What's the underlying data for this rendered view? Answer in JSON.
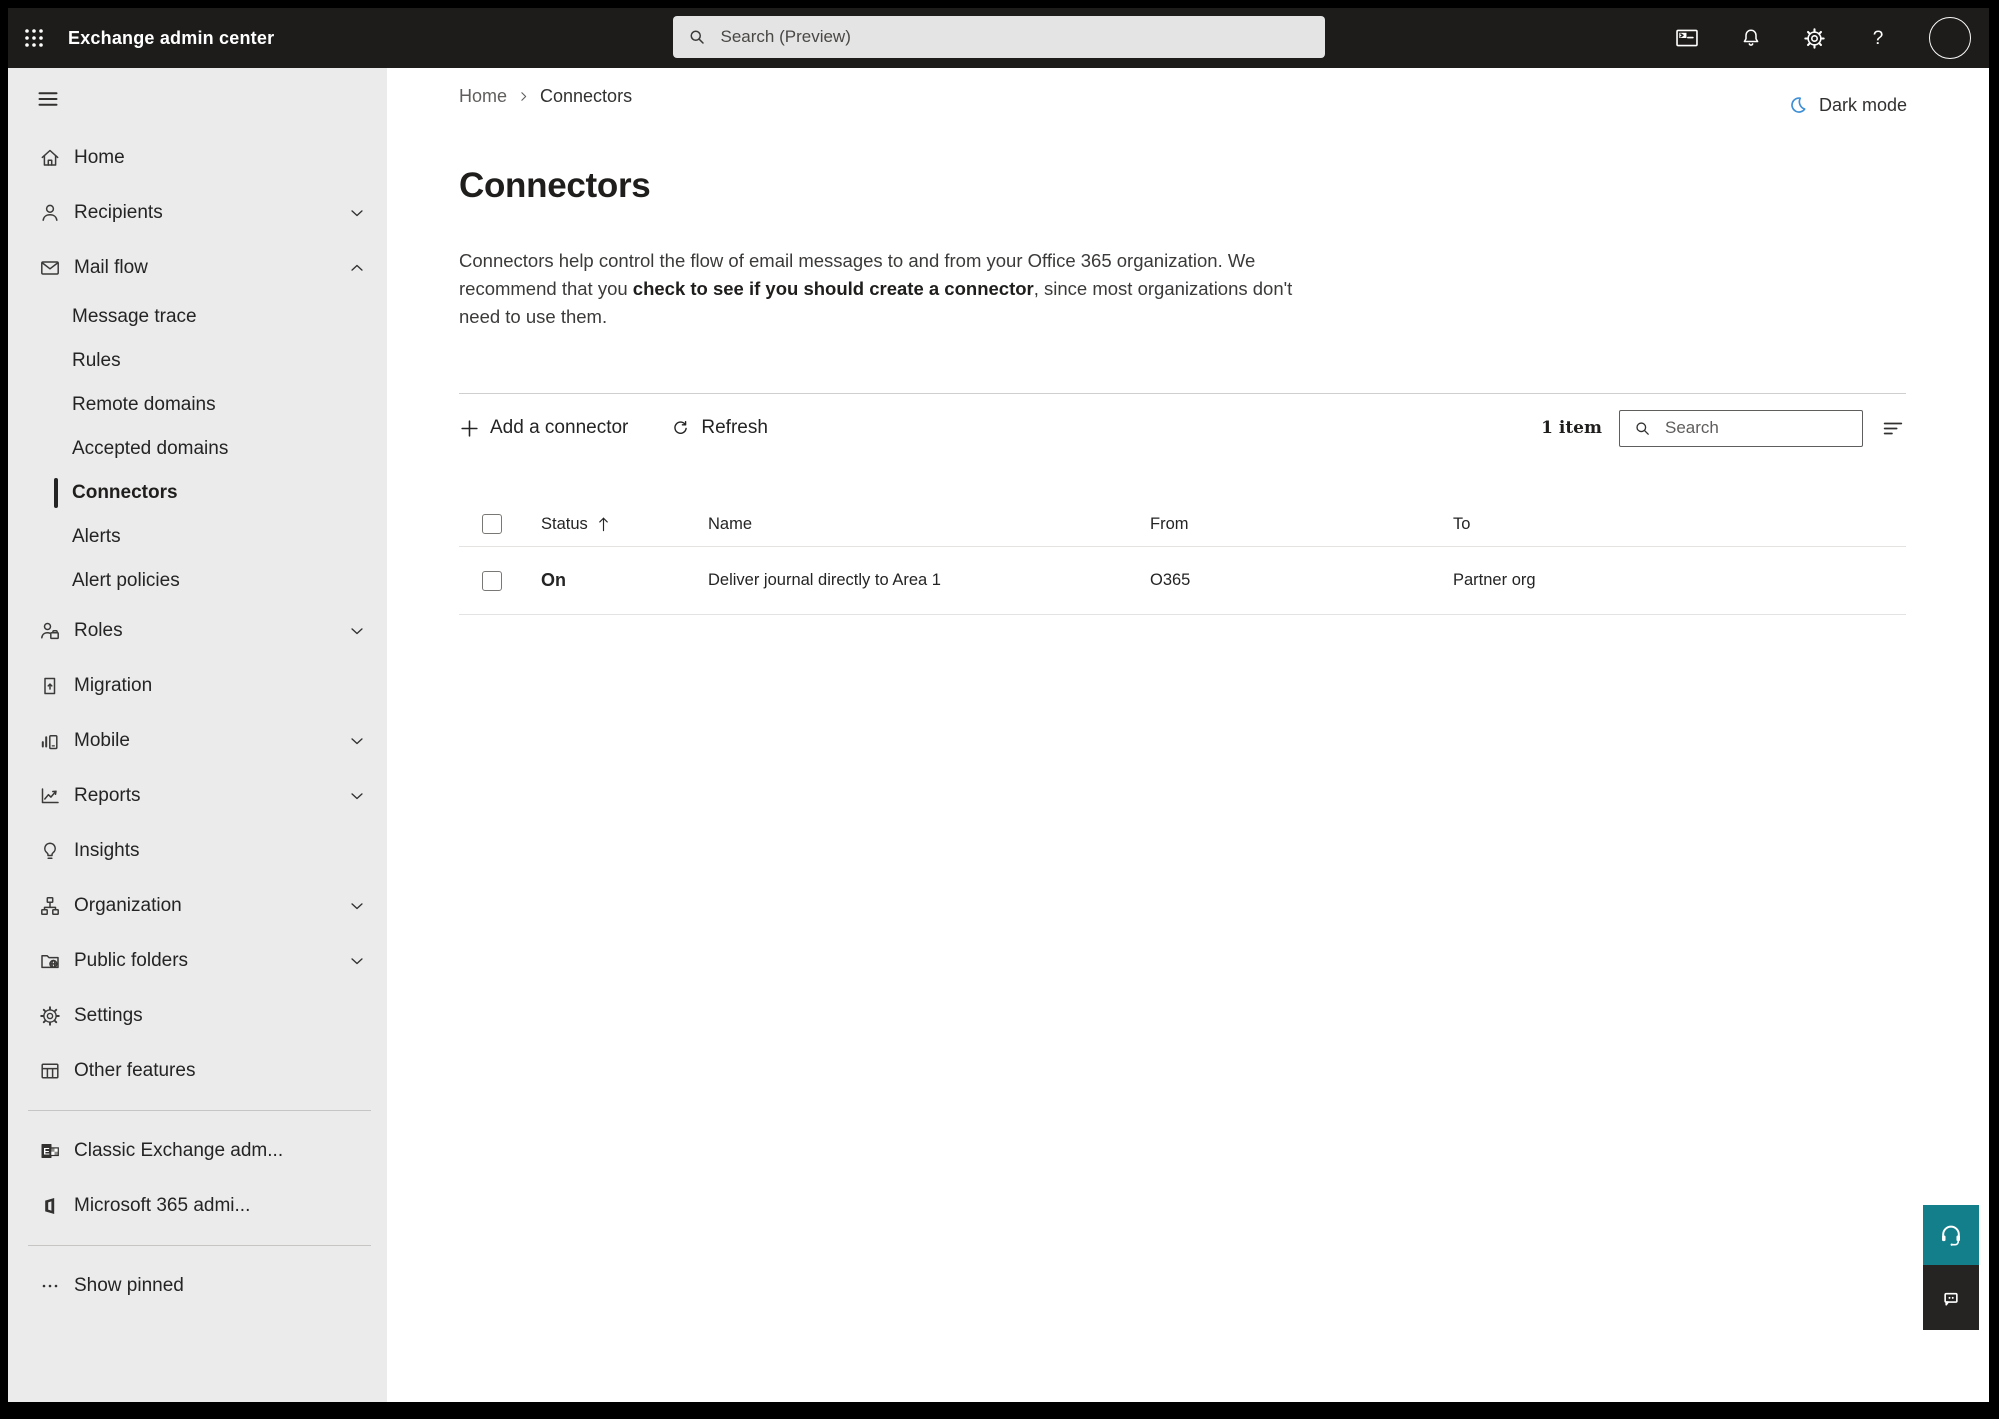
{
  "topbar": {
    "app_title": "Exchange admin center",
    "search_placeholder": "Search (Preview)"
  },
  "sidebar": {
    "items": [
      {
        "label": "Home"
      },
      {
        "label": "Recipients"
      },
      {
        "label": "Mail flow"
      },
      {
        "label": "Message trace"
      },
      {
        "label": "Rules"
      },
      {
        "label": "Remote domains"
      },
      {
        "label": "Accepted domains"
      },
      {
        "label": "Connectors"
      },
      {
        "label": "Alerts"
      },
      {
        "label": "Alert policies"
      },
      {
        "label": "Roles"
      },
      {
        "label": "Migration"
      },
      {
        "label": "Mobile"
      },
      {
        "label": "Reports"
      },
      {
        "label": "Insights"
      },
      {
        "label": "Organization"
      },
      {
        "label": "Public folders"
      },
      {
        "label": "Settings"
      },
      {
        "label": "Other features"
      },
      {
        "label": "Classic Exchange adm..."
      },
      {
        "label": "Microsoft 365 admi..."
      },
      {
        "label": "Show pinned"
      }
    ]
  },
  "breadcrumb": {
    "home": "Home",
    "current": "Connectors"
  },
  "dark_mode_label": "Dark mode",
  "page": {
    "title": "Connectors",
    "desc_part1": "Connectors help control the flow of email messages to and from your Office 365 organization. We recommend that you ",
    "desc_link": "check to see if you should create a connector",
    "desc_part2": ", since most organizations don't need to use them."
  },
  "toolbar": {
    "add_label": "Add a connector",
    "refresh_label": "Refresh",
    "item_count": "1 item",
    "search_placeholder": "Search"
  },
  "table": {
    "columns": [
      "Status",
      "Name",
      "From",
      "To"
    ],
    "rows": [
      {
        "status": "On",
        "name": "Deliver journal directly to Area 1",
        "from": "O365",
        "to": "Partner org"
      }
    ]
  },
  "colors": {
    "teal": "#127f8b",
    "moon_blue": "#3d8fd6",
    "topbar": "#1d1c1b",
    "sidebar": "#ebebeb"
  }
}
